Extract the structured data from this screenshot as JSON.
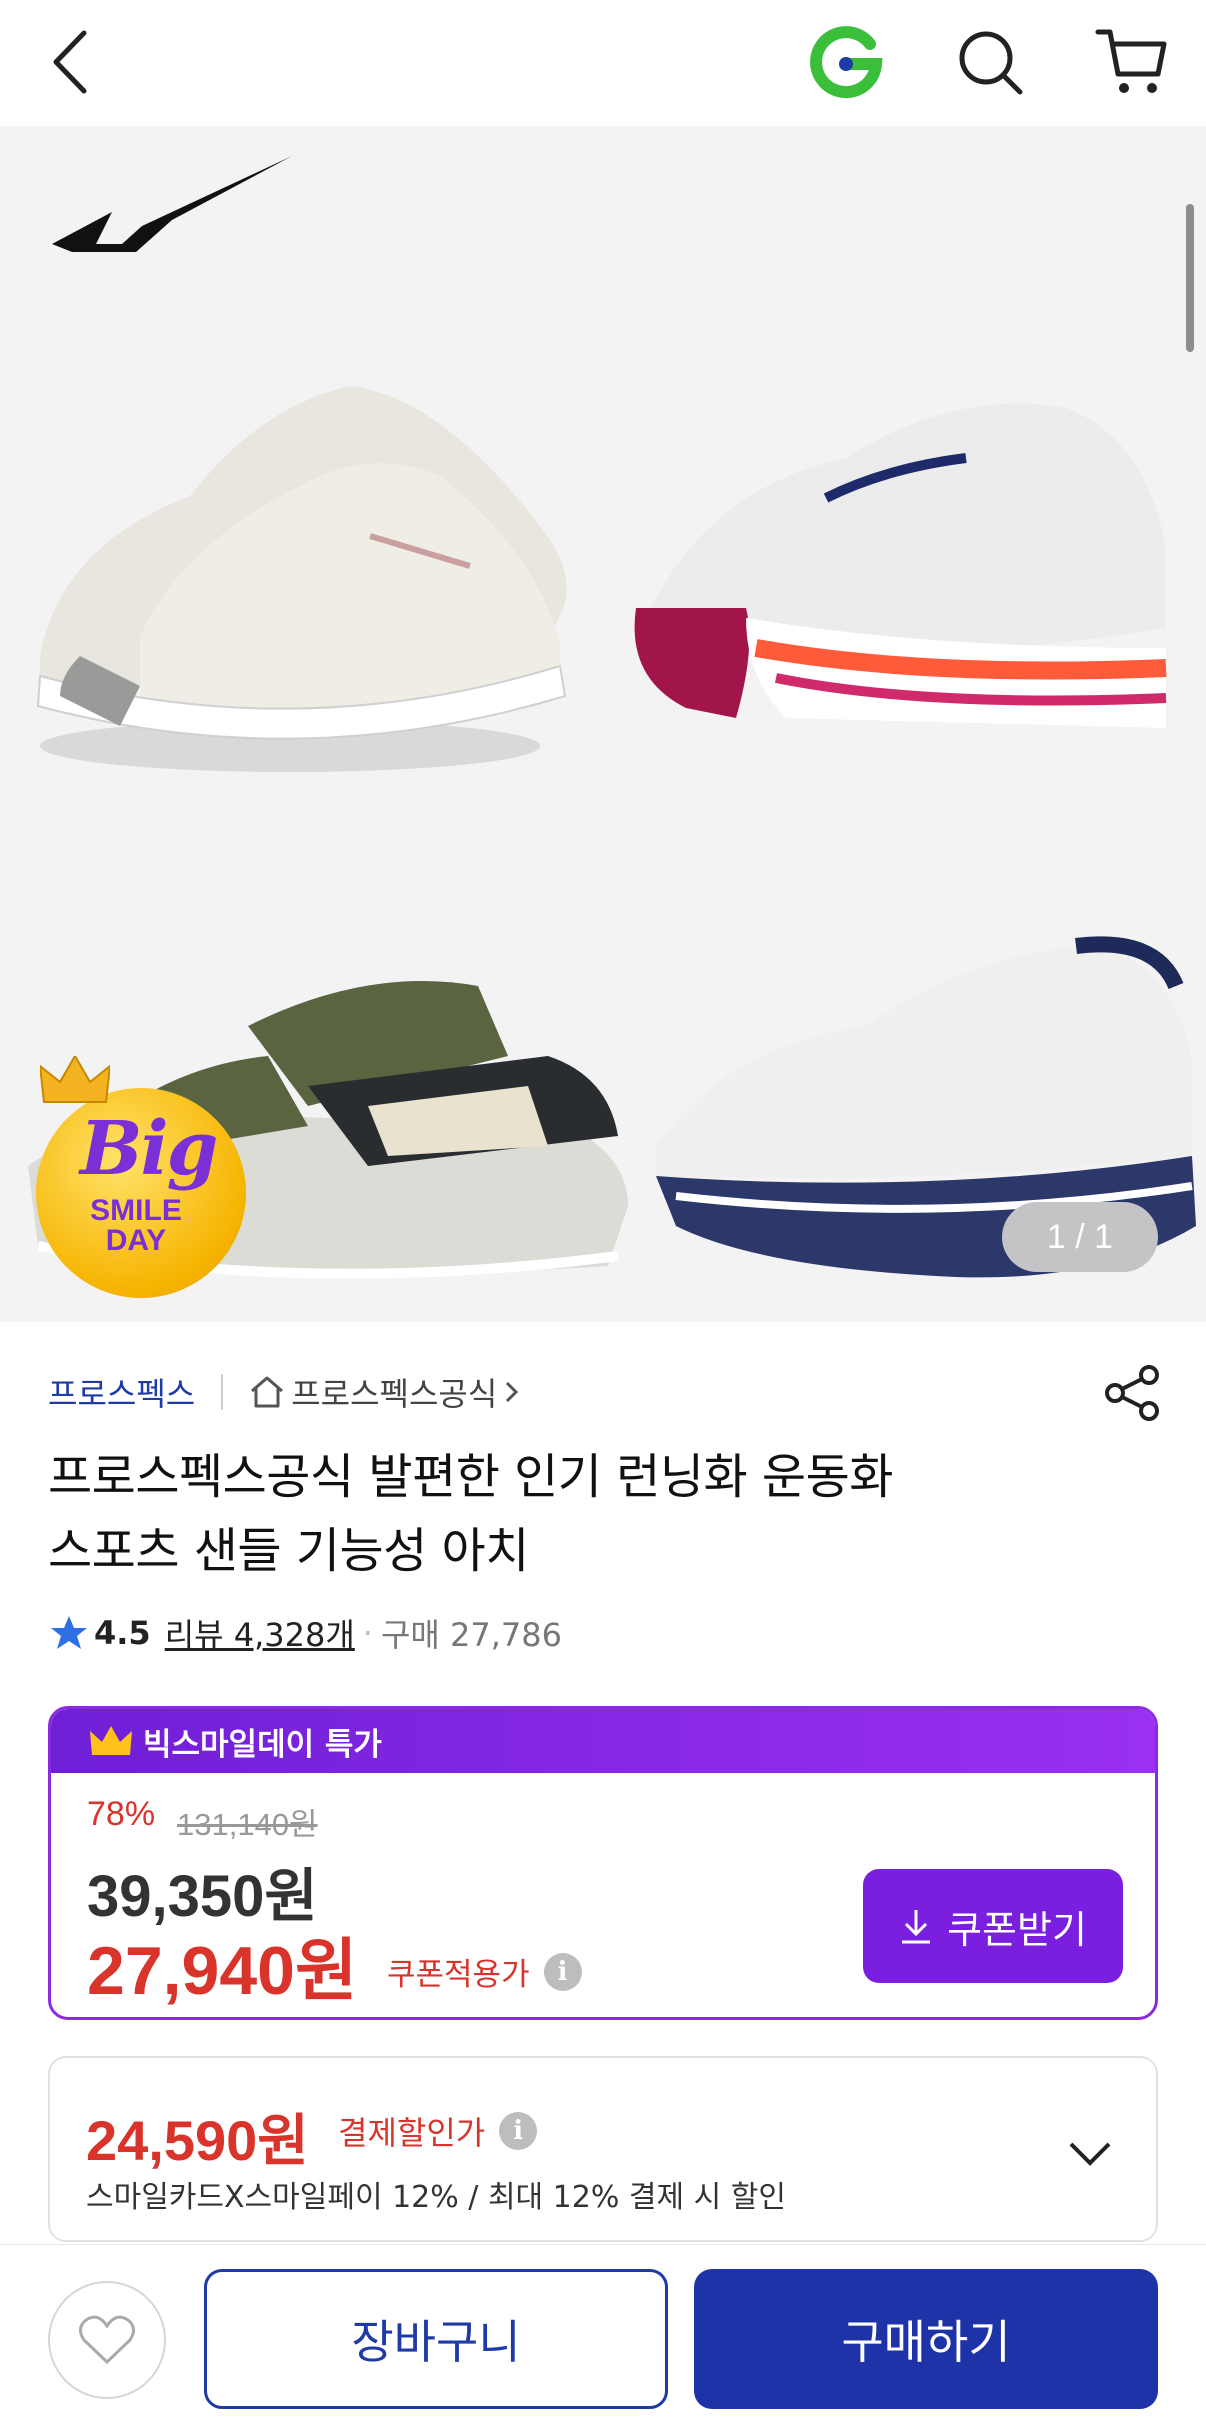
{
  "header": {
    "back_icon": "chevron-left-icon",
    "logo_icon": "g-logo-icon",
    "search_icon": "search-icon",
    "cart_icon": "cart-icon"
  },
  "hero": {
    "pager": "1 / 1",
    "badge": {
      "big": "Big",
      "smile": "SMILE",
      "day": "DAY"
    }
  },
  "product": {
    "brand": "프로스펙스",
    "store": "프로스펙스공식",
    "title_line1": "프로스펙스공식 발편한 인기 런닝화 운동화",
    "title_line2": "스포츠 샌들 기능성 아치",
    "rating": "4.5",
    "reviews": "리뷰 4,328개",
    "purchase": "구매 27,786"
  },
  "deal": {
    "header": "빅스마일데이 특가",
    "discount": "78%",
    "original_price": "131,140원",
    "sale_price": "39,350원",
    "coupon_price": "27,940원",
    "coupon_note": "쿠폰적용가",
    "coupon_button": "쿠폰받기",
    "accent_color": "#7a1fe0",
    "price_color": "#d9342b"
  },
  "payment": {
    "price": "24,590원",
    "note": "결제할인가",
    "description": "스마일카드X스마일페이 12% / 최대 12% 결제 시 할인"
  },
  "bottom": {
    "cart_label": "장바구니",
    "buy_label": "구매하기",
    "brand_color": "#1f33a8"
  }
}
